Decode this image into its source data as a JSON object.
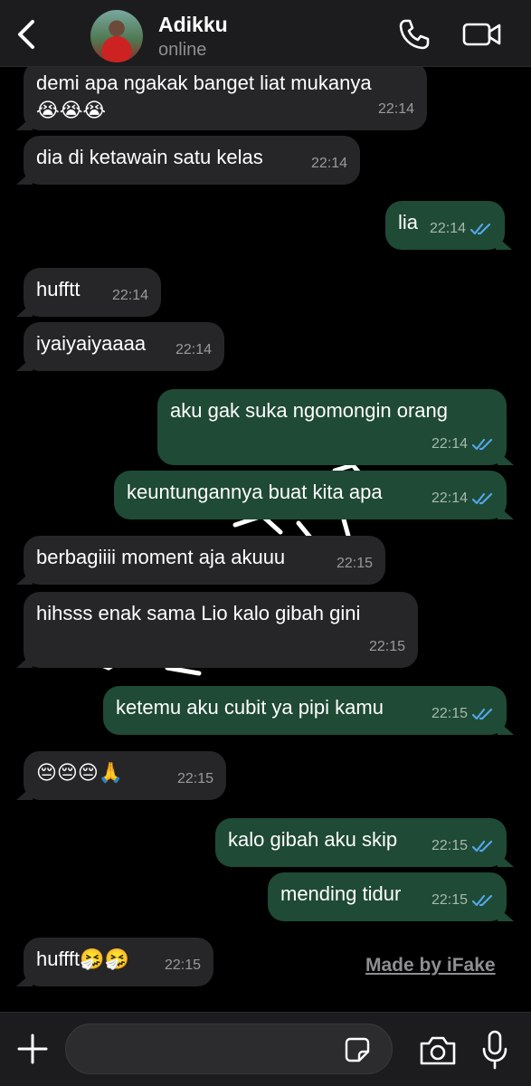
{
  "header": {
    "contact_name": "Adikku",
    "status": "online"
  },
  "messages": [
    {
      "dir": "in",
      "text": "demi apa ngakak banget liat mukanya",
      "text2": "😭😭😭",
      "time": "22:14"
    },
    {
      "dir": "in",
      "text": "dia di ketawain satu kelas",
      "time": "22:14"
    },
    {
      "dir": "out",
      "text": "lia",
      "time": "22:14"
    },
    {
      "dir": "in",
      "text": "hufftt",
      "time": "22:14"
    },
    {
      "dir": "in",
      "text": "iyaiyaiyaaaa",
      "time": "22:14"
    },
    {
      "dir": "out",
      "text": "aku gak suka ngomongin orang",
      "time": "22:14"
    },
    {
      "dir": "out",
      "text": "keuntungannya buat kita apa",
      "time": "22:14"
    },
    {
      "dir": "in",
      "text": "berbagiiii moment aja akuuu",
      "time": "22:15"
    },
    {
      "dir": "in",
      "text": "hihsss enak sama Lio kalo gibah gini",
      "time": "22:15"
    },
    {
      "dir": "out",
      "text": "ketemu aku cubit ya pipi kamu",
      "time": "22:15"
    },
    {
      "dir": "in",
      "text": "😔😔😔🙏",
      "time": "22:15"
    },
    {
      "dir": "out",
      "text": "kalo gibah aku skip",
      "time": "22:15"
    },
    {
      "dir": "out",
      "text": "mending tidur",
      "time": "22:15"
    },
    {
      "dir": "in",
      "text": "huffft🤧🤧",
      "time": "22:15"
    }
  ],
  "watermark": "Made by iFake",
  "composer": {
    "placeholder": ""
  },
  "colors": {
    "incoming_bubble": "#262628",
    "outgoing_bubble": "#1f4a35",
    "read_tick": "#53a6e8"
  }
}
